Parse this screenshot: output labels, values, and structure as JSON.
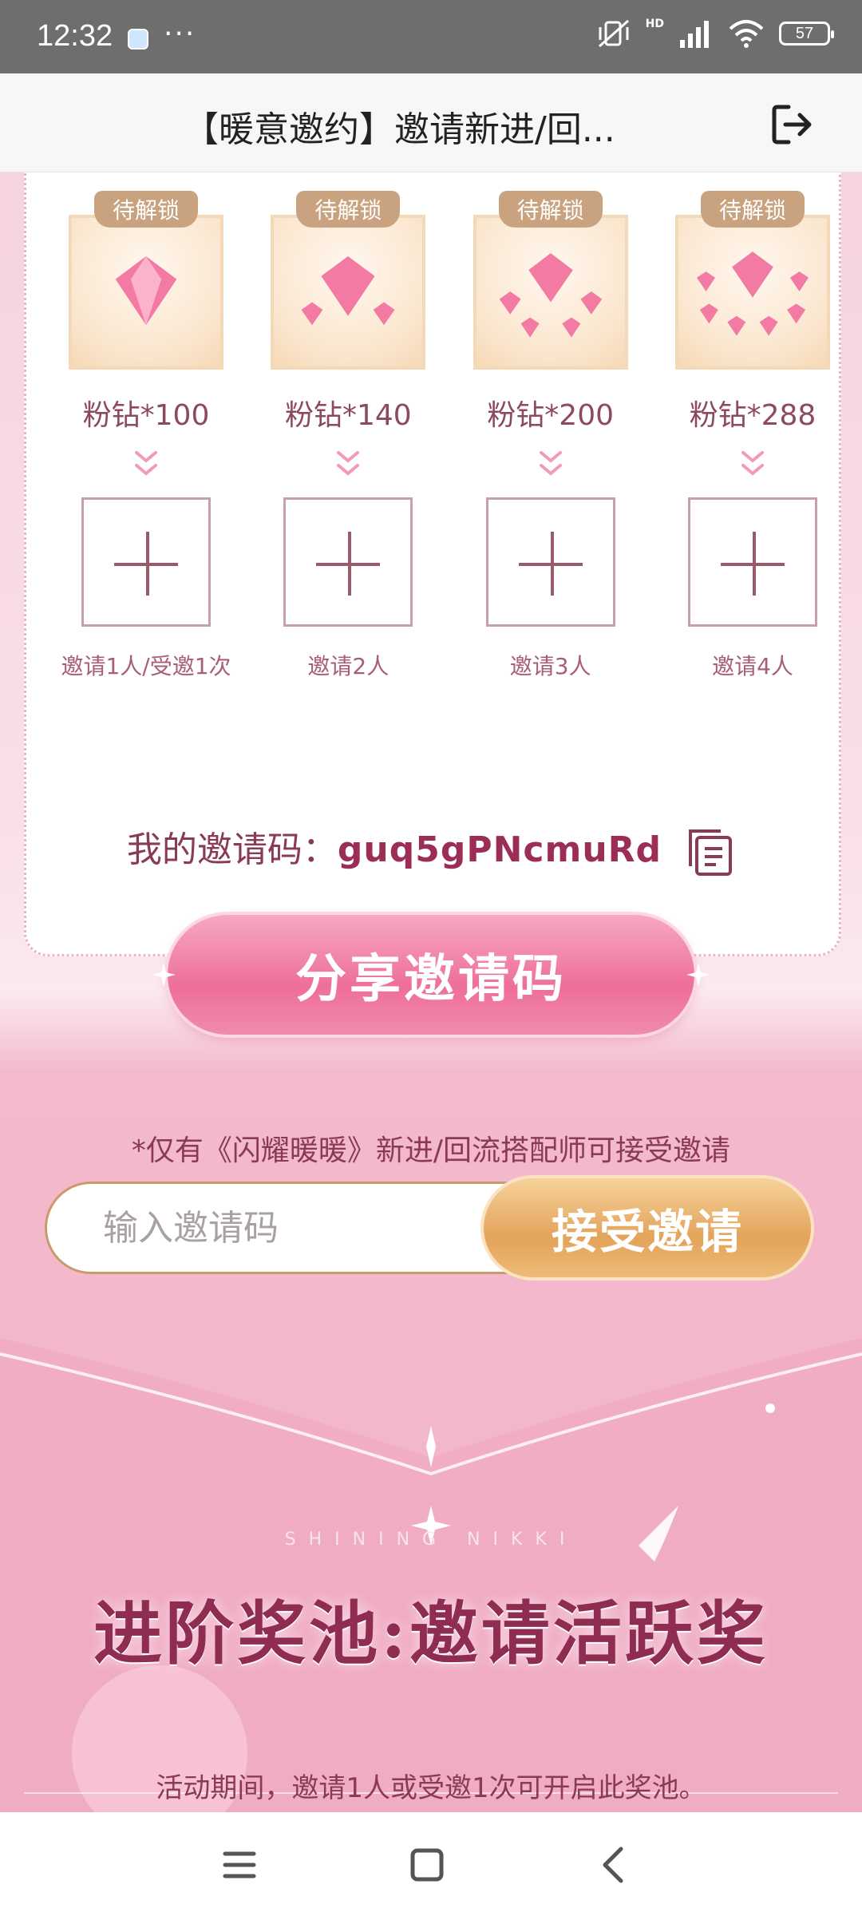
{
  "status_bar": {
    "time": "12:32",
    "dots": "···",
    "hd": "HD",
    "battery": "57"
  },
  "title_bar": {
    "title": "【暖意邀约】邀请新进/回..."
  },
  "rewards": [
    {
      "badge": "待解锁",
      "label": "粉钻*100",
      "slot_label": "邀请1人/受邀1次",
      "gems": 1
    },
    {
      "badge": "待解锁",
      "label": "粉钻*140",
      "slot_label": "邀请2人",
      "gems": 3
    },
    {
      "badge": "待解锁",
      "label": "粉钻*200",
      "slot_label": "邀请3人",
      "gems": 5
    },
    {
      "badge": "待解锁",
      "label": "粉钻*288",
      "slot_label": "邀请4人",
      "gems": 7
    }
  ],
  "invite": {
    "label": "我的邀请码：",
    "code": "guq5gPNcmuRd",
    "share_button": "分享邀请码",
    "notice": "*仅有《闪耀暖暖》新进/回流搭配师可接受邀请",
    "input_placeholder": "输入邀请码",
    "accept_button": "接受邀请"
  },
  "pool": {
    "brand": "SHINING NIKKI",
    "title": "进阶奖池:邀请活跃奖",
    "description": "活动期间，邀请1人或受邀1次可开启此奖池。"
  },
  "colors": {
    "accent_pink": "#ee6e9b",
    "gold": "#e3a35a",
    "text_plum": "#8a3a55"
  }
}
